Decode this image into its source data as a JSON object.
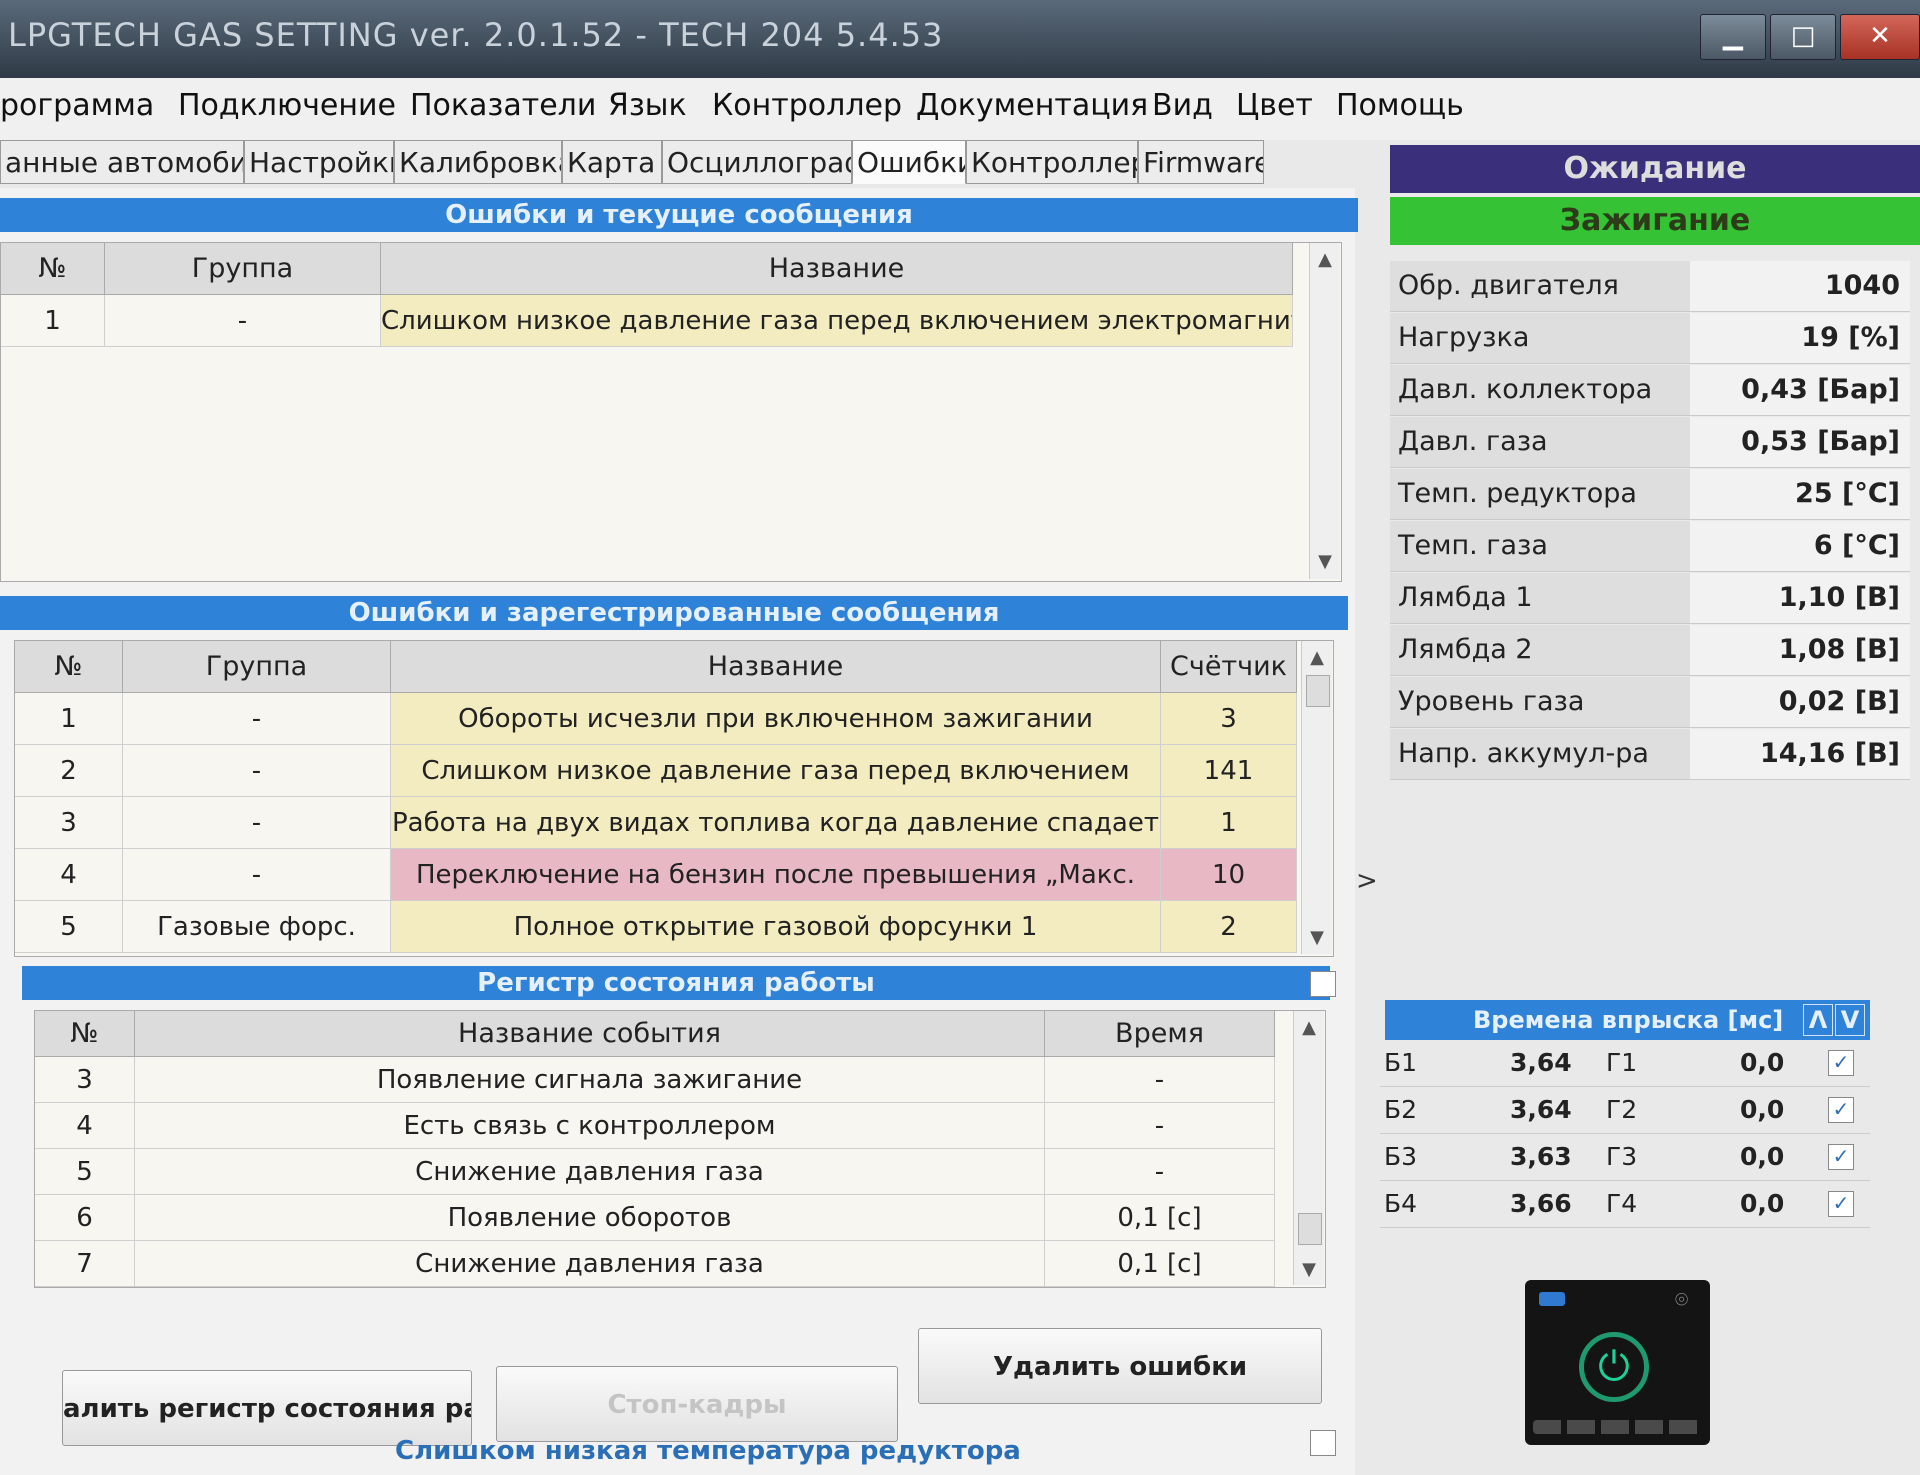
{
  "window": {
    "title": "LPGTECH GAS SETTING ver. 2.0.1.52 - TECH 204 5.4.53"
  },
  "menu": [
    "рограмма",
    "Подключение",
    "Показатели",
    "Язык",
    "Контроллер",
    "Документация",
    "Вид",
    "Цвет",
    "Помощь"
  ],
  "tabs": [
    "анные автомобиля",
    "Настройки",
    "Калибровка",
    "Карта",
    "Осциллограф",
    "Ошибки",
    "Контроллер",
    "Firmware"
  ],
  "current_errors": {
    "title": "Ошибки и текущие сообщения",
    "headers": [
      "№",
      "Группа",
      "Название"
    ],
    "rows": [
      {
        "n": "1",
        "group": "-",
        "name": "Слишком низкое давление газа перед включением электромагнита."
      }
    ]
  },
  "registered_errors": {
    "title": "Ошибки и зарегестрированные сообщения",
    "headers": [
      "№",
      "Группа",
      "Название",
      "Счётчик"
    ],
    "rows": [
      {
        "n": "1",
        "group": "-",
        "name": "Обороты исчезли при включенном зажигании",
        "count": "3"
      },
      {
        "n": "2",
        "group": "-",
        "name": "Слишком низкое давление газа перед включением",
        "count": "141"
      },
      {
        "n": "3",
        "group": "-",
        "name": "Работа  на двух видах топлива когда давление спадает",
        "count": "1"
      },
      {
        "n": "4",
        "group": "-",
        "name": "Переключение на бензин после превышения „Макс.",
        "count": "10"
      },
      {
        "n": "5",
        "group": "Газовые форс.",
        "name": "Полное открытие газовой форсунки 1",
        "count": "2"
      }
    ]
  },
  "event_log": {
    "title": "Регистр состояния работы",
    "headers": [
      "№",
      "Название  события",
      "Время"
    ],
    "rows": [
      {
        "n": "3",
        "name": "Появление сигнала зажигание",
        "time": "-"
      },
      {
        "n": "4",
        "name": "Есть связь с контроллером",
        "time": "-"
      },
      {
        "n": "5",
        "name": "Снижение давления газа",
        "time": "-"
      },
      {
        "n": "6",
        "name": "Появление оборотов",
        "time": "0,1 [c]"
      },
      {
        "n": "7",
        "name": "Снижение давления газа",
        "time": "0,1 [c]"
      }
    ]
  },
  "buttons": {
    "clear_log": "алить регистр состояния рабс",
    "freeze_frames": "Стоп-кадры",
    "delete_errors": "Удалить ошибки"
  },
  "status_message": "Слишком низкая температура редуктора",
  "right_panel": {
    "mode": "Ожидание",
    "ignition": "Зажигание",
    "collapse_arrow": ">",
    "params": [
      {
        "label": "Обр. двигателя",
        "value": "1040"
      },
      {
        "label": "Нагрузка",
        "value": "19 [%]"
      },
      {
        "label": "Давл. коллектора",
        "value": "0,43 [Бар]"
      },
      {
        "label": "Давл. газа",
        "value": "0,53 [Бар]"
      },
      {
        "label": "Темп. редуктора",
        "value": "25 [°C]"
      },
      {
        "label": "Темп. газа",
        "value": "6 [°C]"
      },
      {
        "label": "Лямбда 1",
        "value": "1,10 [B]"
      },
      {
        "label": "Лямбда 2",
        "value": "1,08 [B]"
      },
      {
        "label": "Уровень газа",
        "value": "0,02 [B]"
      },
      {
        "label": "Напр. аккумул-ра",
        "value": "14,16 [B]"
      }
    ],
    "injection": {
      "title": "Времена впрыска [мс]",
      "up": "Λ",
      "down": "V",
      "rows": [
        {
          "b": "Б1",
          "bval": "3,64",
          "g": "Г1",
          "gval": "0,0"
        },
        {
          "b": "Б2",
          "bval": "3,64",
          "g": "Г2",
          "gval": "0,0"
        },
        {
          "b": "Б3",
          "bval": "3,63",
          "g": "Г3",
          "gval": "0,0"
        },
        {
          "b": "Б4",
          "bval": "3,66",
          "g": "Г4",
          "gval": "0,0"
        }
      ]
    }
  },
  "colors": {
    "header_blue": "#2e83d8",
    "mode_bg": "#3a2f7a",
    "ignition_bg": "#35c235",
    "row_yellow": "#f3ecc0",
    "row_pink": "#e8b8c4"
  }
}
